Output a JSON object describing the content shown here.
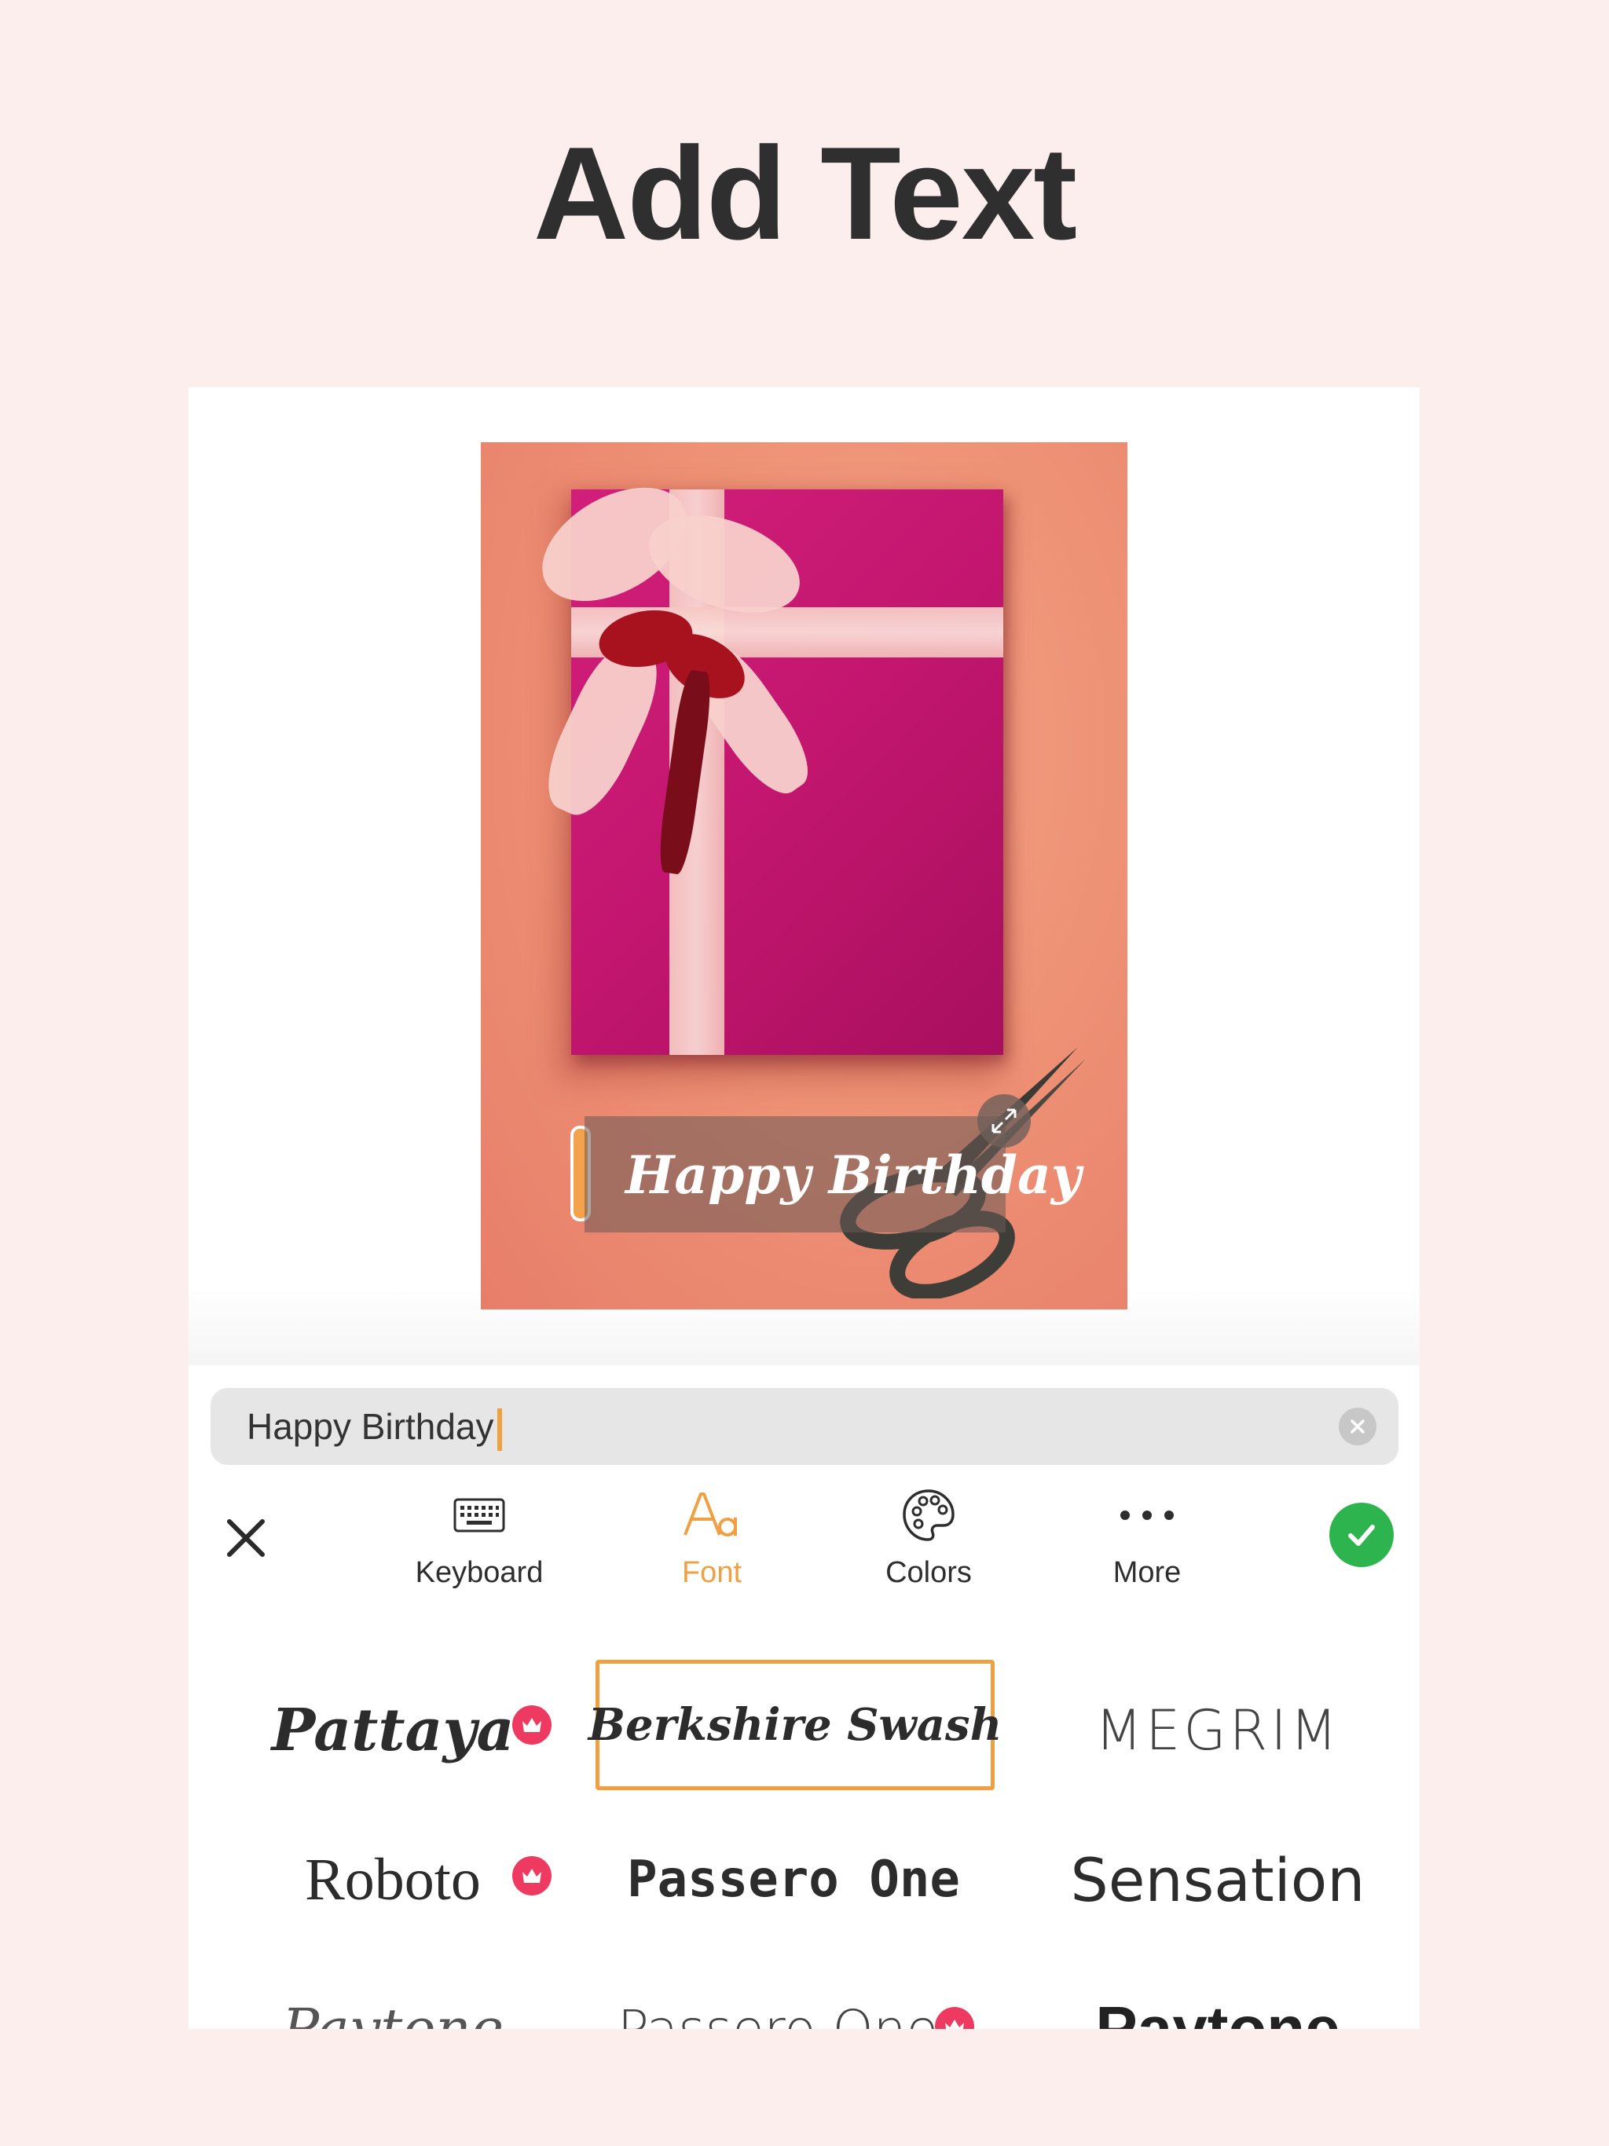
{
  "headline": "Add Text",
  "canvas": {
    "overlay_text": "Happy Birthday"
  },
  "input": {
    "value": "Happy Birthday"
  },
  "toolbar": {
    "keyboard_label": "Keyboard",
    "font_label": "Font",
    "colors_label": "Colors",
    "more_label": "More",
    "active_tab": "Font"
  },
  "fonts": [
    {
      "name": "Pattaya",
      "premium": true
    },
    {
      "name": "Berkshire Swash",
      "premium": false,
      "selected": true
    },
    {
      "name": "Megrim",
      "premium": false,
      "display": "MEGRIM"
    },
    {
      "name": "Roboto",
      "premium": true
    },
    {
      "name": "Passero One",
      "premium": false
    },
    {
      "name": "Sensation",
      "premium": false
    },
    {
      "name": "Paytone",
      "premium": false
    },
    {
      "name": "Passero One",
      "premium": true
    },
    {
      "name": "Paytone",
      "premium": false
    }
  ],
  "colors": {
    "accent": "#f0a040",
    "confirm": "#2eb44f",
    "premium_badge": "#ee3a60",
    "background": "#fdeeee"
  }
}
